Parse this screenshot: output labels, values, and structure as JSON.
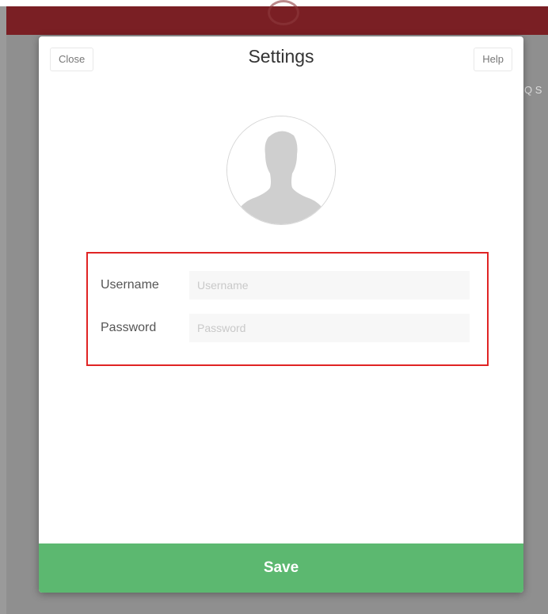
{
  "background": {
    "search_hint": "Q S"
  },
  "modal": {
    "title": "Settings",
    "close_label": "Close",
    "help_label": "Help",
    "avatar_icon": "person-silhouette-icon",
    "form": {
      "username_label": "Username",
      "username_placeholder": "Username",
      "username_value": "",
      "password_label": "Password",
      "password_placeholder": "Password",
      "password_value": ""
    },
    "save_label": "Save"
  },
  "colors": {
    "header_bg": "#7a1f24",
    "save_bg": "#5cb870",
    "highlight_border": "#e02424"
  }
}
